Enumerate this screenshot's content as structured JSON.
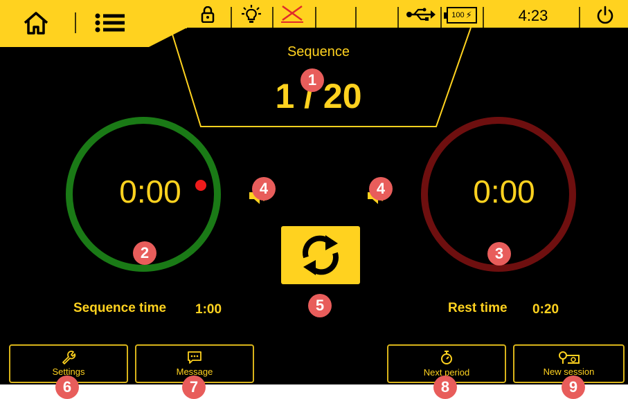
{
  "status_bar": {
    "clock": "4:23",
    "battery_level": "100",
    "icons": [
      "home-icon",
      "menu-icon",
      "lock-icon",
      "light-bulb-icon",
      "wireless-off-icon",
      "usb-icon",
      "battery-icon",
      "power-icon"
    ]
  },
  "sequence": {
    "title": "Sequence",
    "counter": "1 / 20"
  },
  "timers": {
    "sequence": {
      "time": "0:00",
      "label": "Sequence time",
      "value": "1:00",
      "ring_color": "#1a7a16"
    },
    "rest": {
      "time": "0:00",
      "label": "Rest time",
      "value": "0:20",
      "ring_color": "#6e0f0f"
    }
  },
  "buttons": {
    "settings": "Settings",
    "message": "Message",
    "next_period": "Next period",
    "new_session": "New session"
  },
  "callouts": [
    "1",
    "2",
    "3",
    "4",
    "4",
    "5",
    "6",
    "7",
    "8",
    "9"
  ],
  "colors": {
    "accent": "#ffd21f",
    "background": "#000000",
    "callout": "#e85d5b"
  }
}
